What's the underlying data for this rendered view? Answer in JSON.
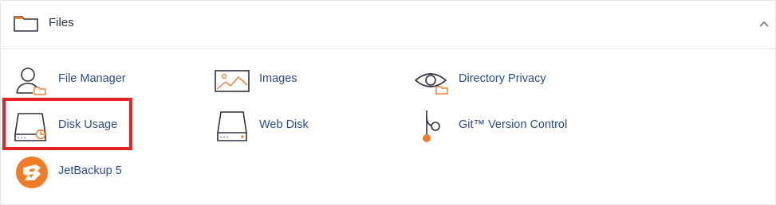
{
  "section": {
    "title": "Files",
    "icon": "folder-icon",
    "collapse_icon": "chevron-up-icon"
  },
  "items": [
    {
      "label": "File Manager",
      "icon": "file-manager-icon"
    },
    {
      "label": "Images",
      "icon": "image-icon"
    },
    {
      "label": "Directory Privacy",
      "icon": "eye-folder-icon"
    },
    {
      "label": "Disk Usage",
      "icon": "disk-usage-icon"
    },
    {
      "label": "Web Disk",
      "icon": "drive-icon"
    },
    {
      "label": "Git™ Version Control",
      "icon": "git-branch-icon"
    },
    {
      "label": "JetBackup 5",
      "icon": "jetbackup-logo-icon"
    }
  ],
  "colors": {
    "accent_orange": "#f07c2a",
    "link_blue": "#2a4b8a",
    "highlight_red": "#e32424",
    "icon_stroke": "#2c3240"
  }
}
